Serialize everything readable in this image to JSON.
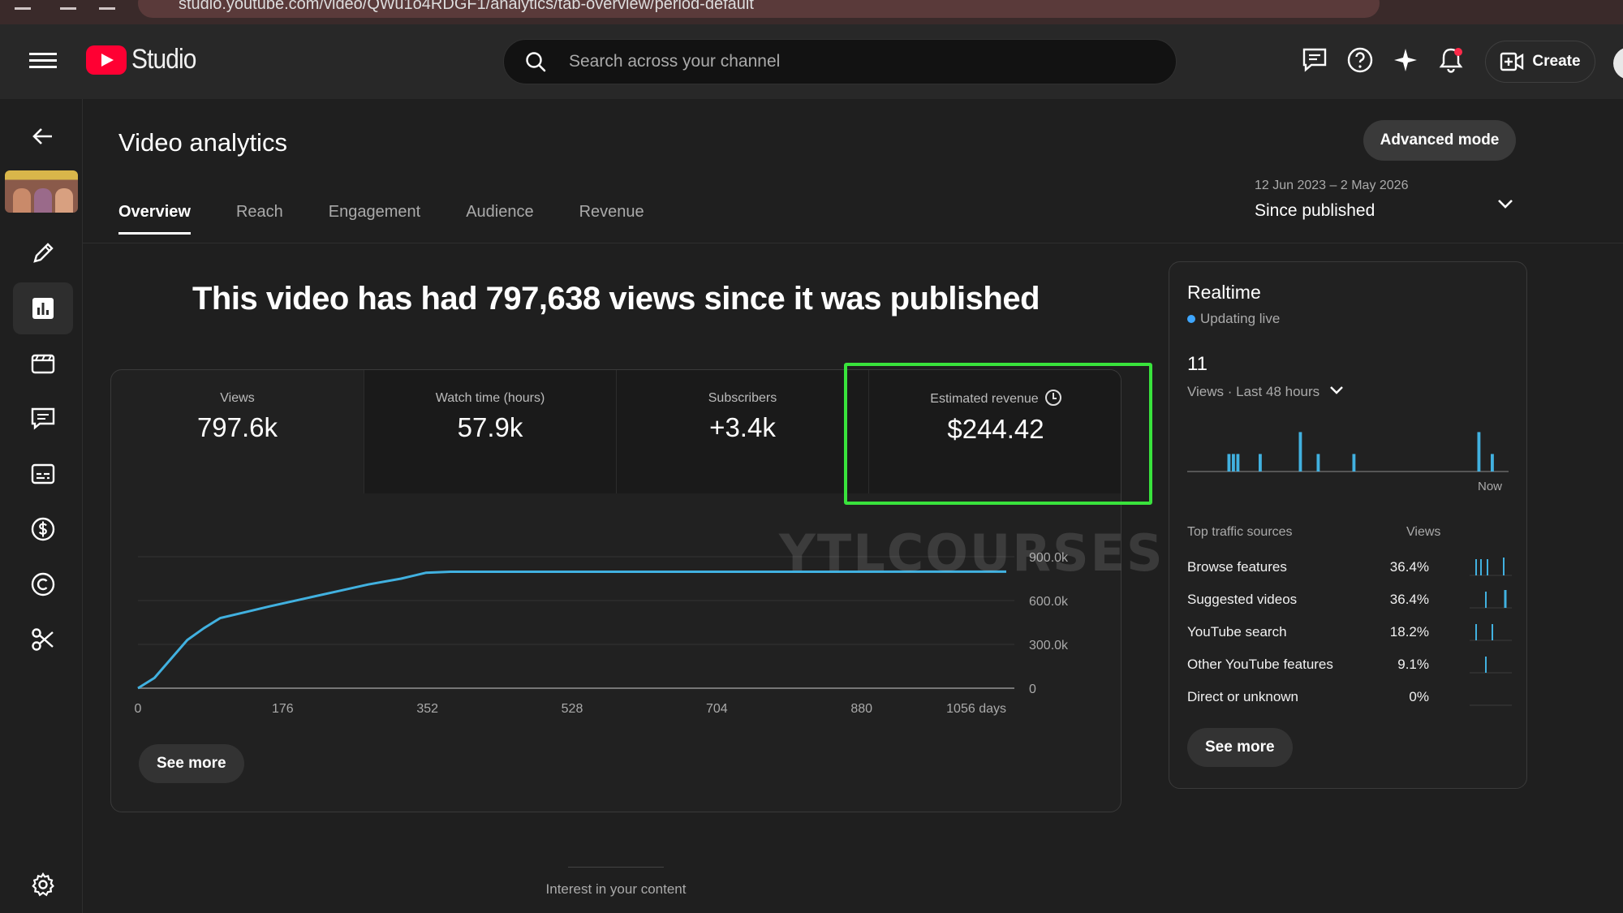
{
  "browser": {
    "url": "studio.youtube.com/video/QWu1o4RDGF1/analytics/tab-overview/period-default"
  },
  "topbar": {
    "brand": "Studio",
    "search_placeholder": "Search across your channel",
    "create_label": "Create"
  },
  "page": {
    "title": "Video analytics",
    "advanced_mode_label": "Advanced mode",
    "tabs": [
      "Overview",
      "Reach",
      "Engagement",
      "Audience",
      "Revenue"
    ],
    "active_tab": "Overview",
    "period": {
      "range": "12 Jun 2023 – 2 May 2026",
      "label": "Since published"
    },
    "headline": "This video has had 797,638 views since it was published",
    "see_more_label": "See more",
    "interest_label": "Interest in your content"
  },
  "metrics": [
    {
      "label": "Views",
      "value": "797.6k"
    },
    {
      "label": "Watch time (hours)",
      "value": "57.9k"
    },
    {
      "label": "Subscribers",
      "value": "+3.4k"
    },
    {
      "label": "Estimated revenue",
      "value": "$244.42"
    }
  ],
  "chart_data": {
    "type": "line",
    "title": "",
    "xlabel": "",
    "ylabel": "",
    "x_ticks": [
      "0",
      "176",
      "352",
      "528",
      "704",
      "880",
      "1056 days"
    ],
    "y_ticks": [
      "900.0k",
      "600.0k",
      "300.0k",
      "0"
    ],
    "xlim": [
      0,
      1056
    ],
    "ylim": [
      0,
      900000
    ],
    "series": [
      {
        "name": "",
        "color": "#41b1e0",
        "x": [
          0,
          20,
          40,
          60,
          80,
          100,
          130,
          160,
          200,
          240,
          280,
          320,
          350,
          380,
          450,
          600,
          800,
          1056
        ],
        "y": [
          0,
          70000,
          200000,
          330000,
          410000,
          480000,
          520000,
          560000,
          610000,
          660000,
          710000,
          750000,
          790000,
          797000,
          797200,
          797400,
          797500,
          797638
        ]
      }
    ]
  },
  "realtime": {
    "title": "Realtime",
    "status": "Updating live",
    "count": "11",
    "subtitle": "Views · Last 48 hours",
    "now_label": "Now",
    "bars": [
      0,
      0,
      0,
      0,
      0,
      0,
      0,
      0,
      0,
      1,
      1,
      1,
      0,
      0,
      0,
      0,
      1,
      0,
      0,
      0,
      0,
      0,
      0,
      0,
      0,
      3,
      0,
      0,
      0,
      1,
      0,
      0,
      0,
      0,
      0,
      0,
      0,
      1,
      0,
      0,
      0,
      0,
      0,
      0,
      0,
      0,
      0,
      0,
      0,
      0,
      0,
      0,
      0,
      0,
      0,
      0,
      0,
      0,
      0,
      0,
      0,
      0,
      0,
      0,
      0,
      3,
      0,
      0,
      1,
      0,
      0,
      0
    ],
    "traffic_header": "Top traffic sources",
    "views_header": "Views",
    "sources": [
      {
        "name": "Browse features",
        "pct": "36.4%"
      },
      {
        "name": "Suggested videos",
        "pct": "36.4%"
      },
      {
        "name": "YouTube search",
        "pct": "18.2%"
      },
      {
        "name": "Other YouTube features",
        "pct": "9.1%"
      },
      {
        "name": "Direct or unknown",
        "pct": "0%"
      }
    ],
    "see_more_label": "See more"
  },
  "watermark": "YTLCOURSES.IN",
  "colors": {
    "accent": "#3ea6ff",
    "chart_line": "#41b1e0",
    "highlight": "#39e33c",
    "brand_red": "#ff0033"
  }
}
